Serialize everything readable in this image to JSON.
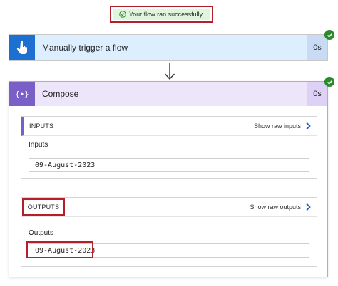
{
  "banner": {
    "message": "Your flow ran successfully."
  },
  "trigger": {
    "title": "Manually trigger a flow",
    "duration": "0s",
    "icon": "touch-hand-icon",
    "accent": "#1d6fd1"
  },
  "compose": {
    "title": "Compose",
    "duration": "0s",
    "icon_text": "{∙}",
    "accent": "#7a5fc6",
    "inputs_section": {
      "header": "INPUTS",
      "raw_link": "Show raw inputs",
      "field_label": "Inputs",
      "value": "09-August-2023"
    },
    "outputs_section": {
      "header": "OUTPUTS",
      "raw_link": "Show raw outputs",
      "field_label": "Outputs",
      "value": "09-August-2023"
    }
  },
  "colors": {
    "success": "#2a8a2a",
    "highlight": "#b51f2a"
  }
}
